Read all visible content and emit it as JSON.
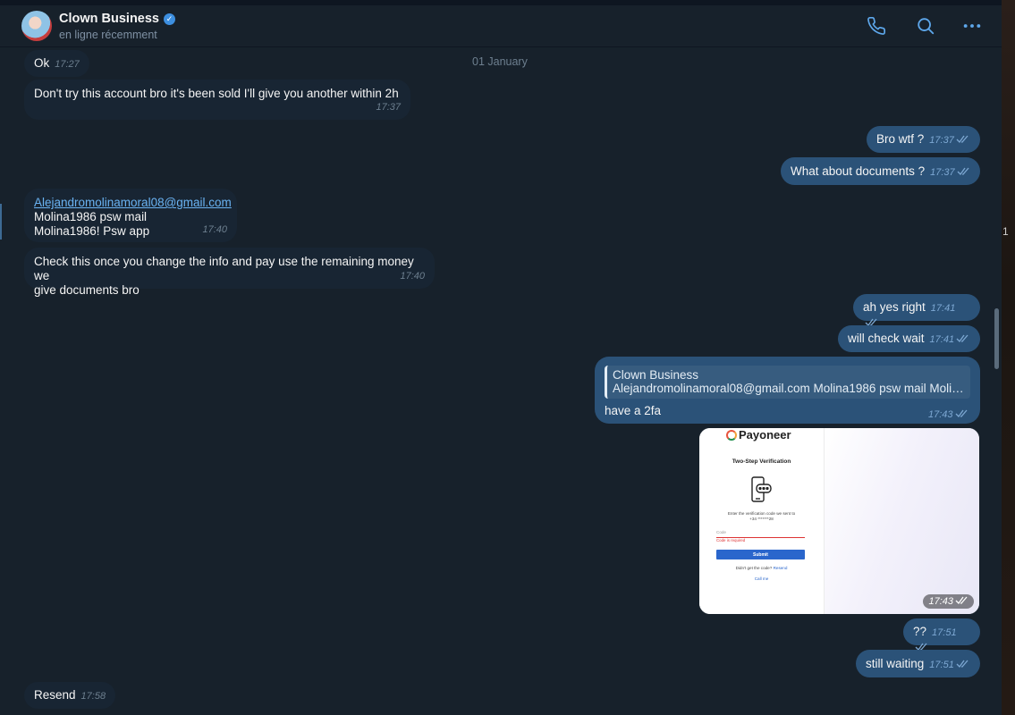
{
  "header": {
    "title": "Clown Business",
    "status": "en ligne récemment"
  },
  "side_digit": "1",
  "date_separator": "01 January",
  "messages": {
    "m1": {
      "text": "Ok",
      "time": "17:27"
    },
    "m2": {
      "text": "Don't try this account bro it's been sold I'll give you another within 2h",
      "time": "17:37"
    },
    "m3": {
      "text": "Bro wtf ?",
      "time": "17:37"
    },
    "m4": {
      "text": "What about documents ?",
      "time": "17:37"
    },
    "m5": {
      "email": "Alejandromolinamoral08@gmail.com",
      "line2": "Molina1986 psw mail",
      "line3": "Molina1986! Psw app",
      "time": "17:40"
    },
    "m6": {
      "line1": "Check this once you change the info and pay use the remaining money we",
      "line2": "give documents bro",
      "time": "17:40"
    },
    "m7": {
      "text": "ah yes right",
      "time": "17:41"
    },
    "m8": {
      "text": "will check wait",
      "time": "17:41"
    },
    "m9": {
      "reply_name": "Clown Business",
      "reply_text": "Alejandromolinamoral08@gmail.com Molina1986 psw mail Molina...",
      "text": "have a 2fa",
      "time": "17:43"
    },
    "m10": {
      "time": "17:43",
      "screenshot": {
        "brand": "Payoneer",
        "heading": "Two-Step Verification",
        "instruction": "Enter the verification code we sent to",
        "phone": "+34 *******28",
        "code_placeholder": "Code",
        "error": "Code is required",
        "submit": "Submit",
        "didnt_get": "Didn't get the code?",
        "resend": "Resend",
        "call_me": "Call me"
      }
    },
    "m11": {
      "text": "??",
      "time": "17:51"
    },
    "m12": {
      "text": "still waiting",
      "time": "17:51"
    },
    "m13": {
      "text": "Resend",
      "time": "17:58"
    }
  },
  "colors": {
    "background": "#17212b",
    "incoming_bubble": "#182533",
    "outgoing_bubble": "#2b5278",
    "accent": "#6ab3f3"
  }
}
